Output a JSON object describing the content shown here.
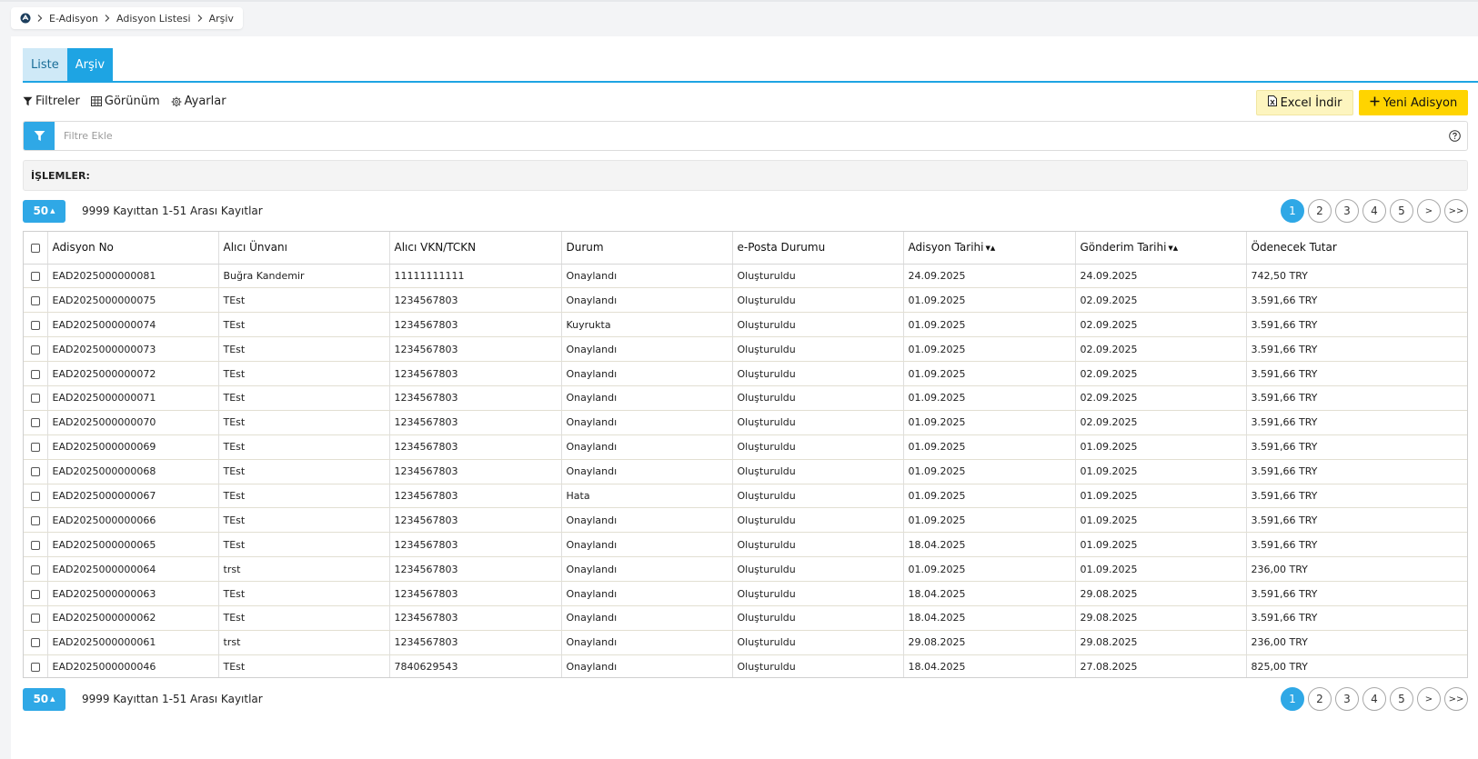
{
  "breadcrumb": {
    "items": [
      "E-Adisyon",
      "Adisyon Listesi",
      "Arşiv"
    ]
  },
  "tabs": [
    {
      "label": "Liste"
    },
    {
      "label": "Arşiv"
    }
  ],
  "toolbar": {
    "filters_label": "Filtreler",
    "view_label": "Görünüm",
    "settings_label": "Ayarlar",
    "excel_label": "Excel İndir",
    "new_label": "Yeni Adisyon"
  },
  "filter": {
    "placeholder": "Filtre Ekle"
  },
  "actions": {
    "label": "İŞLEMLER:"
  },
  "pagination": {
    "page_size": "50",
    "summary": "9999 Kayıttan 1-51 Arası Kayıtlar",
    "pages": [
      "1",
      "2",
      "3",
      "4",
      "5"
    ],
    "current_page": "1",
    "next_label": ">",
    "last_label": ">>"
  },
  "table": {
    "headers": [
      "Adisyon No",
      "Alıcı Ünvanı",
      "Alıcı VKN/TCKN",
      "Durum",
      "e-Posta Durumu",
      "Adisyon Tarihi",
      "Gönderim Tarihi",
      "Ödenecek Tutar"
    ],
    "rows": [
      [
        "EAD2025000000081",
        "Buğra Kandemir",
        "11111111111",
        "Onaylandı",
        "Oluşturuldu",
        "24.09.2025",
        "24.09.2025",
        "742,50 TRY"
      ],
      [
        "EAD2025000000075",
        "TEst",
        "1234567803",
        "Onaylandı",
        "Oluşturuldu",
        "01.09.2025",
        "02.09.2025",
        "3.591,66 TRY"
      ],
      [
        "EAD2025000000074",
        "TEst",
        "1234567803",
        "Kuyrukta",
        "Oluşturuldu",
        "01.09.2025",
        "02.09.2025",
        "3.591,66 TRY"
      ],
      [
        "EAD2025000000073",
        "TEst",
        "1234567803",
        "Onaylandı",
        "Oluşturuldu",
        "01.09.2025",
        "02.09.2025",
        "3.591,66 TRY"
      ],
      [
        "EAD2025000000072",
        "TEst",
        "1234567803",
        "Onaylandı",
        "Oluşturuldu",
        "01.09.2025",
        "02.09.2025",
        "3.591,66 TRY"
      ],
      [
        "EAD2025000000071",
        "TEst",
        "1234567803",
        "Onaylandı",
        "Oluşturuldu",
        "01.09.2025",
        "02.09.2025",
        "3.591,66 TRY"
      ],
      [
        "EAD2025000000070",
        "TEst",
        "1234567803",
        "Onaylandı",
        "Oluşturuldu",
        "01.09.2025",
        "02.09.2025",
        "3.591,66 TRY"
      ],
      [
        "EAD2025000000069",
        "TEst",
        "1234567803",
        "Onaylandı",
        "Oluşturuldu",
        "01.09.2025",
        "01.09.2025",
        "3.591,66 TRY"
      ],
      [
        "EAD2025000000068",
        "TEst",
        "1234567803",
        "Onaylandı",
        "Oluşturuldu",
        "01.09.2025",
        "01.09.2025",
        "3.591,66 TRY"
      ],
      [
        "EAD2025000000067",
        "TEst",
        "1234567803",
        "Hata",
        "Oluşturuldu",
        "01.09.2025",
        "01.09.2025",
        "3.591,66 TRY"
      ],
      [
        "EAD2025000000066",
        "TEst",
        "1234567803",
        "Onaylandı",
        "Oluşturuldu",
        "01.09.2025",
        "01.09.2025",
        "3.591,66 TRY"
      ],
      [
        "EAD2025000000065",
        "TEst",
        "1234567803",
        "Onaylandı",
        "Oluşturuldu",
        "18.04.2025",
        "01.09.2025",
        "3.591,66 TRY"
      ],
      [
        "EAD2025000000064",
        "trst",
        "1234567803",
        "Onaylandı",
        "Oluşturuldu",
        "01.09.2025",
        "01.09.2025",
        "236,00 TRY"
      ],
      [
        "EAD2025000000063",
        "TEst",
        "1234567803",
        "Onaylandı",
        "Oluşturuldu",
        "18.04.2025",
        "29.08.2025",
        "3.591,66 TRY"
      ],
      [
        "EAD2025000000062",
        "TEst",
        "1234567803",
        "Onaylandı",
        "Oluşturuldu",
        "18.04.2025",
        "29.08.2025",
        "3.591,66 TRY"
      ],
      [
        "EAD2025000000061",
        "trst",
        "1234567803",
        "Onaylandı",
        "Oluşturuldu",
        "29.08.2025",
        "29.08.2025",
        "236,00 TRY"
      ],
      [
        "EAD2025000000046",
        "TEst",
        "7840629543",
        "Onaylandı",
        "Oluşturuldu",
        "18.04.2025",
        "27.08.2025",
        "825,00 TRY"
      ]
    ]
  },
  "colors": {
    "accent": "#2fa8e6",
    "tab_active": "#1ea4e3",
    "new_button": "#ffd400",
    "excel_button": "#fdf5bf"
  },
  "icons": {
    "home": "logo-icon",
    "filter": "filter-icon",
    "view": "grid-icon",
    "settings": "gear-icon",
    "excel": "excel-file-icon",
    "add": "plus-icon",
    "help": "question-circle-icon"
  }
}
